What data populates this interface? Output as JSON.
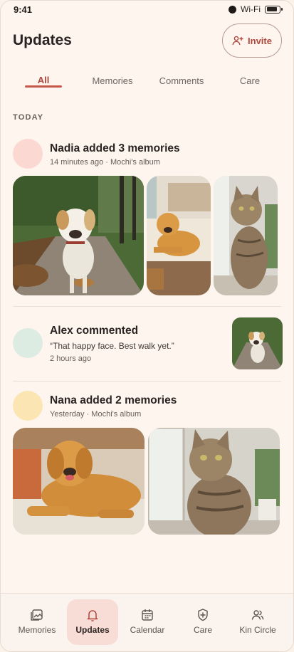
{
  "status_bar": {
    "time": "9:41",
    "wifi_label": "Wi-Fi"
  },
  "header": {
    "title": "Updates",
    "invite_label": "Invite"
  },
  "tabs": [
    {
      "label": "All",
      "active": true
    },
    {
      "label": "Memories",
      "active": false
    },
    {
      "label": "Comments",
      "active": false
    },
    {
      "label": "Care",
      "active": false
    }
  ],
  "section_label": "TODAY",
  "feed": [
    {
      "title": "Nadia added 3 memories",
      "meta": "14 minutes ago · Mochi's album",
      "avatar_color": "#fbd9d2",
      "photos": [
        "terrier-walking-photo",
        "golden-retriever-sofa-photo",
        "tabby-cat-window-photo"
      ]
    },
    {
      "title": "Alex commented",
      "quote": "“That happy face. Best walk yet.”",
      "meta": "2 hours ago",
      "avatar_color": "#dcece2",
      "photos": [
        "terrier-walking-thumbnail"
      ]
    },
    {
      "title": "Nana added 2 memories",
      "meta": "Yesterday · Mochi's album",
      "avatar_color": "#fbe6b3",
      "photos": [
        "golden-retriever-lying-photo",
        "tabby-cat-sitting-photo"
      ]
    }
  ],
  "bottom_nav": [
    {
      "label": "Memories",
      "icon": "photo-album-icon",
      "active": false
    },
    {
      "label": "Updates",
      "icon": "bell-icon",
      "active": true
    },
    {
      "label": "Calendar",
      "icon": "calendar-icon",
      "active": false
    },
    {
      "label": "Care",
      "icon": "shield-plus-icon",
      "active": false
    },
    {
      "label": "Kin Circle",
      "icon": "people-icon",
      "active": false
    }
  ],
  "colors": {
    "accent": "#b0483e",
    "background": "#fdf5ee",
    "active_nav": "#f8dcd6"
  }
}
